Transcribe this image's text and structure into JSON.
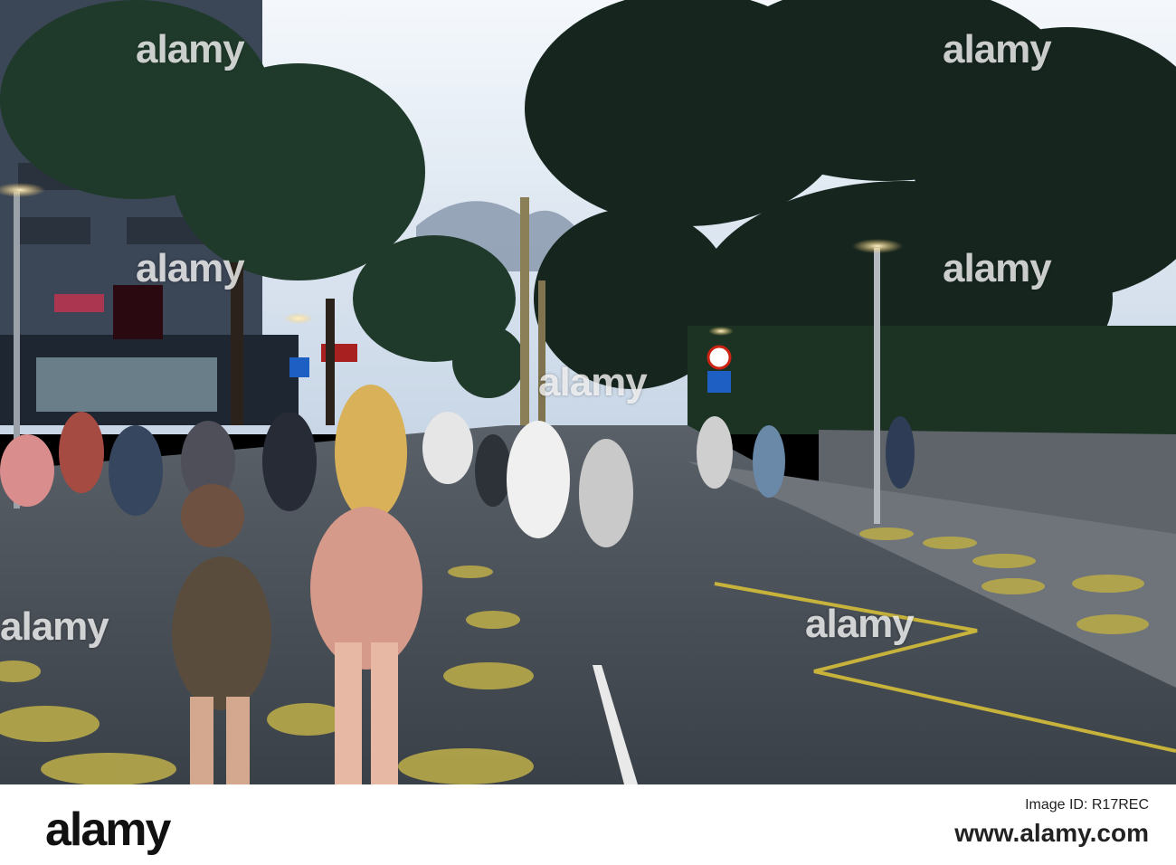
{
  "watermark": {
    "text": "alamy"
  },
  "footer": {
    "logo_text": "alamy",
    "caption_label": "Image ID: R17REC",
    "site_text": "www.alamy.com"
  },
  "palette": {
    "sky": "#e6eef6",
    "trees": "#1f3a2b",
    "road": "#434c55",
    "yellow_dots": "#b7a94a",
    "lamp_glow": "#ffd88a"
  }
}
